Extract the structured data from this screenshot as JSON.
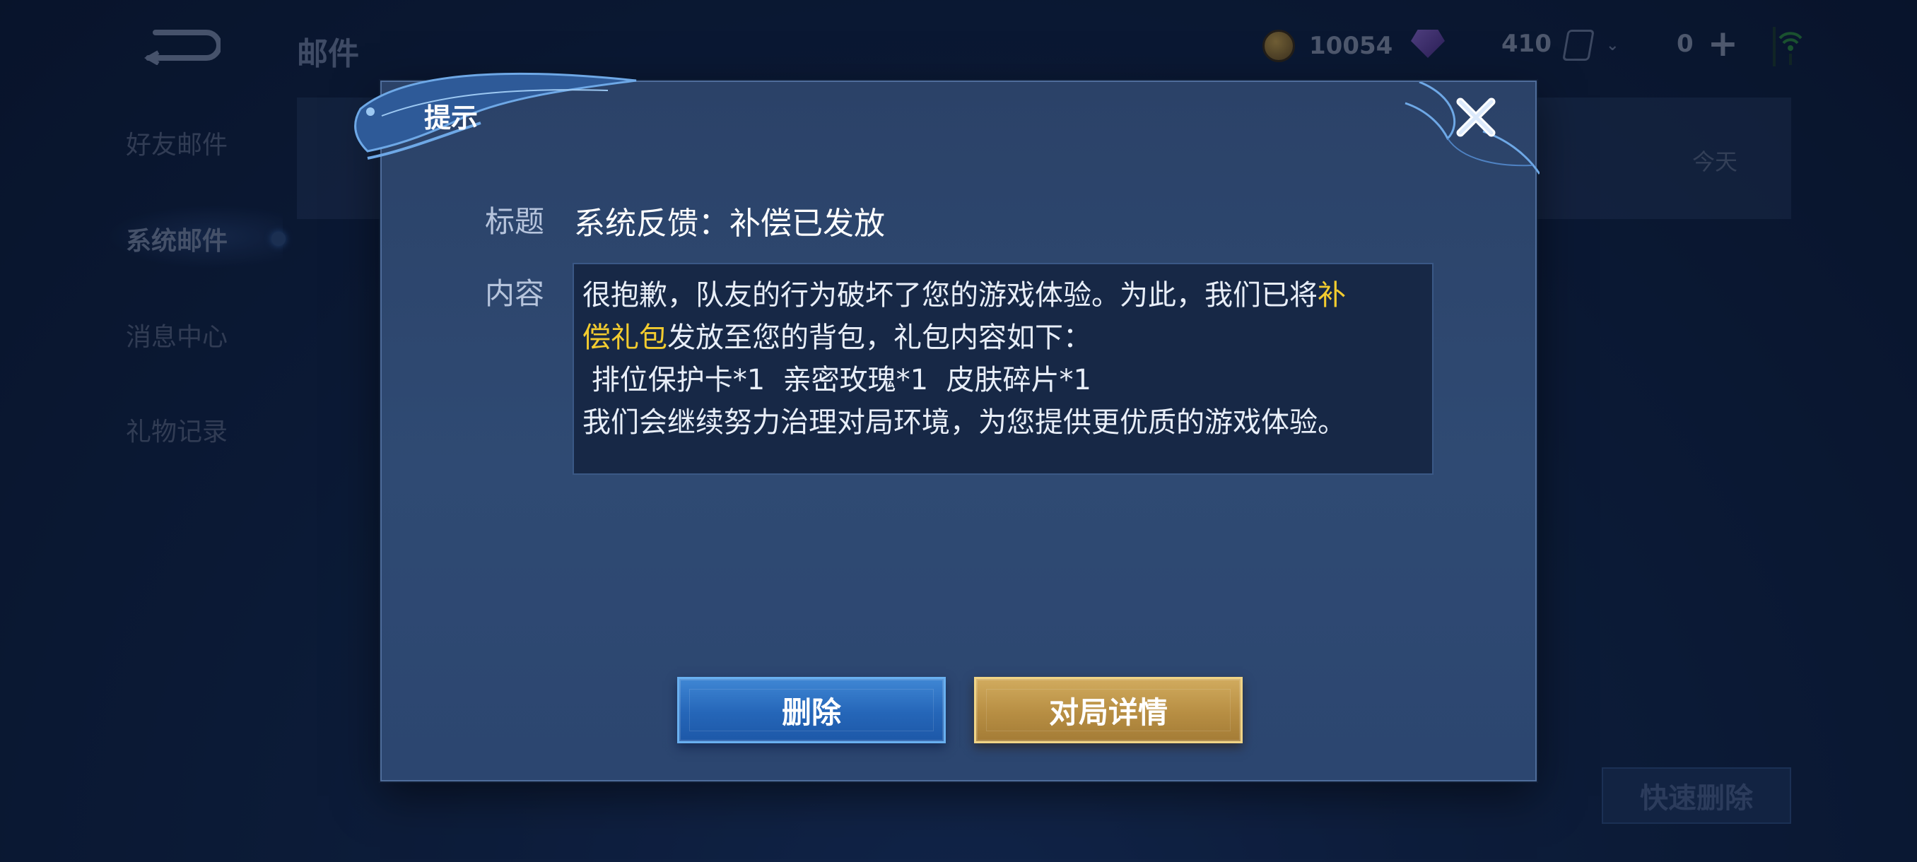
{
  "topbar": {
    "page_title": "邮件",
    "coin_amount": "10054",
    "gem_amount": "410",
    "ticket_count": "0",
    "plus_symbol": "+"
  },
  "sidebar": {
    "items": [
      {
        "label": "好友邮件"
      },
      {
        "label": "系统邮件"
      },
      {
        "label": "消息中心"
      },
      {
        "label": "礼物记录"
      }
    ]
  },
  "mail_list": {
    "row_date": "今天",
    "quick_delete_label": "快速删除"
  },
  "dialog": {
    "title": "提示",
    "subject_label": "标题",
    "subject": "系统反馈：补偿已发放",
    "content_label": "内容",
    "content": {
      "line1_prefix": "很抱歉，队友的行为破坏了您的游戏体验。为此，我们已将",
      "line1_highlight": "补",
      "line2_highlight": "偿礼包",
      "line2_suffix": "发放至您的背包，礼包内容如下：",
      "line3": " 排位保护卡*1  亲密玫瑰*1  皮肤碎片*1",
      "line4": "我们会继续努力治理对局环境，为您提供更优质的游戏体验。"
    },
    "delete_label": "删除",
    "detail_label": "对局详情"
  },
  "colors": {
    "highlight": "#f3cc2f",
    "delete_button": "#2566b8",
    "detail_button": "#b78e43"
  },
  "icons": [
    "back-icon",
    "coin-icon",
    "gem-icon",
    "ticket-icon",
    "plus-icon",
    "wifi-icon",
    "close-icon"
  ]
}
